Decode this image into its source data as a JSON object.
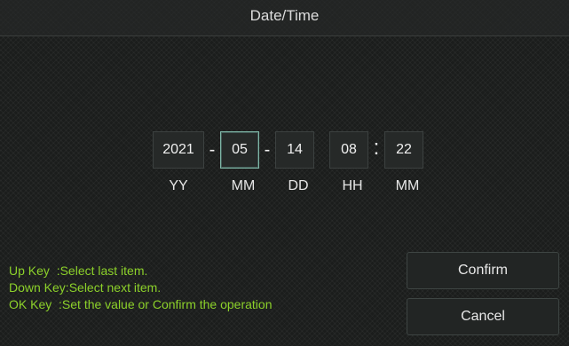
{
  "title": "Date/Time",
  "date_fields": {
    "year": "2021",
    "month": "05",
    "day": "14",
    "hour": "08",
    "minute": "22",
    "sep_date": "-",
    "sep_time": ":"
  },
  "units": {
    "year": "YY",
    "month": "MM",
    "day": "DD",
    "hour": "HH",
    "minute": "MM"
  },
  "active_field": "month",
  "help": {
    "line1": "Up Key  :Select last item.",
    "line2": "Down Key:Select next item.",
    "line3": "OK Key  :Set the value or Confirm the operation"
  },
  "buttons": {
    "confirm": "Confirm",
    "cancel": "Cancel"
  },
  "colors": {
    "help_text": "#8cd12a",
    "active_border": "#7fb8a8"
  }
}
